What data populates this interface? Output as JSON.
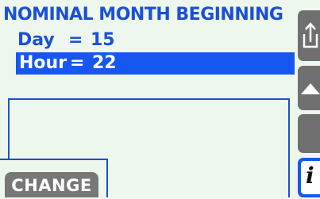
{
  "header": {
    "title": "NOMINAL MONTH BEGINNING"
  },
  "params": [
    {
      "label": "Day",
      "eq": "=",
      "value": "15",
      "selected": false
    },
    {
      "label": "Hour",
      "eq": "=",
      "value": "22",
      "selected": true
    }
  ],
  "footer": {
    "change_label": "CHANGE"
  },
  "sidebar": {
    "buttons": [
      {
        "icon": "export-icon"
      },
      {
        "icon": "up-arrow-icon"
      },
      {
        "icon": "blank"
      },
      {
        "icon": "info-icon",
        "glyph": "i"
      }
    ]
  },
  "colors": {
    "accent": "#1a4fd8",
    "selection": "#1657f0",
    "button": "#777777",
    "background": "#eef7ee"
  }
}
